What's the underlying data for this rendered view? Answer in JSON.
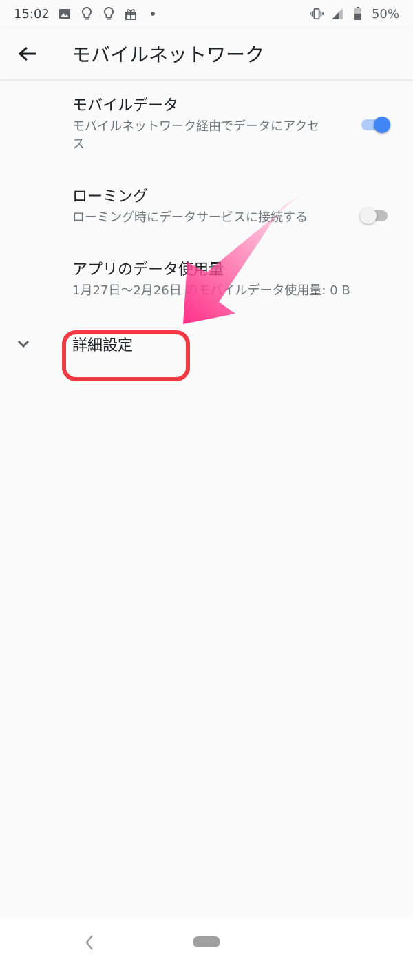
{
  "status_bar": {
    "time": "15:02",
    "battery": "50%",
    "icons": [
      "image-icon",
      "lightbulb-icon",
      "lightbulb-icon",
      "gift-icon",
      "dot-icon",
      "vibrate-icon",
      "signal-icon",
      "battery-icon"
    ]
  },
  "app_bar": {
    "title": "モバイルネットワーク"
  },
  "preferences": [
    {
      "title": "モバイルデータ",
      "summary": "モバイルネットワーク経由でデータにアクセス",
      "switch": "on"
    },
    {
      "title": "ローミング",
      "summary": "ローミング時にデータサービスに接続する",
      "switch": "off"
    },
    {
      "title": "アプリのデータ使用量",
      "summary": "1月27日〜2月26日 のモバイルデータ使用量: 0 B"
    }
  ],
  "advanced": {
    "label": "詳細設定"
  },
  "colors": {
    "accent": "#4285f4",
    "highlight": "#f23a44",
    "arrow": "#ff4f9a"
  }
}
